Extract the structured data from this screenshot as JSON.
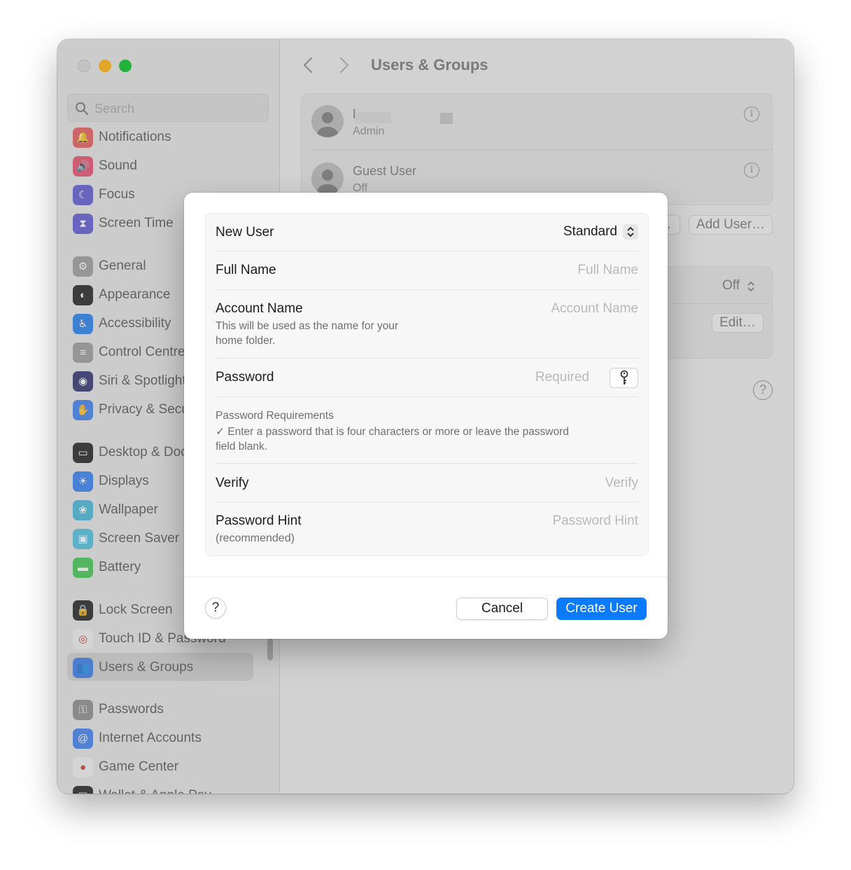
{
  "window": {
    "title": "Users & Groups"
  },
  "sidebar": {
    "search_placeholder": "Search",
    "items": [
      {
        "label": "Notifications",
        "icon": "bell-icon",
        "color": "#e8575b"
      },
      {
        "label": "Sound",
        "icon": "speaker-icon",
        "color": "#e84b6a"
      },
      {
        "label": "Focus",
        "icon": "moon-icon",
        "color": "#5c56d4"
      },
      {
        "label": "Screen Time",
        "icon": "hourglass-icon",
        "color": "#5c56d4"
      },
      {
        "label": "General",
        "icon": "gear-icon",
        "color": "#9b9b9b"
      },
      {
        "label": "Appearance",
        "icon": "appearance-icon",
        "color": "#1c1c1e"
      },
      {
        "label": "Accessibility",
        "icon": "accessibility-icon",
        "color": "#1e7cf1"
      },
      {
        "label": "Control Centre",
        "icon": "toggles-icon",
        "color": "#9b9b9b"
      },
      {
        "label": "Siri & Spotlight",
        "icon": "siri-icon",
        "color": "#2b2b6a"
      },
      {
        "label": "Privacy & Security",
        "icon": "hand-icon",
        "color": "#3a7cf0"
      },
      {
        "label": "Desktop & Dock",
        "icon": "dock-icon",
        "color": "#1c1c1e"
      },
      {
        "label": "Displays",
        "icon": "sun-icon",
        "color": "#2f7cf6"
      },
      {
        "label": "Wallpaper",
        "icon": "flower-icon",
        "color": "#41b8d8"
      },
      {
        "label": "Screen Saver",
        "icon": "screensaver-icon",
        "color": "#49bfe0"
      },
      {
        "label": "Battery",
        "icon": "battery-icon",
        "color": "#3ec650"
      },
      {
        "label": "Lock Screen",
        "icon": "lock-icon",
        "color": "#1c1c1e"
      },
      {
        "label": "Touch ID & Password",
        "icon": "fingerprint-icon",
        "color": "#f2f2f2"
      },
      {
        "label": "Users & Groups",
        "icon": "users-icon",
        "color": "#3a7cf0"
      },
      {
        "label": "Passwords",
        "icon": "key-icon",
        "color": "#8a8a8a"
      },
      {
        "label": "Internet Accounts",
        "icon": "at-icon",
        "color": "#3a7cf0"
      },
      {
        "label": "Game Center",
        "icon": "gamecenter-icon",
        "color": "#f2f2f2"
      },
      {
        "label": "Wallet & Apple Pay",
        "icon": "wallet-icon",
        "color": "#1c1c1e"
      }
    ]
  },
  "main": {
    "users": [
      {
        "name": "l",
        "role": "Admin"
      },
      {
        "name": "Guest User",
        "role": "Off"
      }
    ],
    "add_user_label": "Add User…",
    "off_label": "Off",
    "edit_label": "Edit…",
    "help_label": "?"
  },
  "dialog": {
    "new_user_label": "New User",
    "account_type": "Standard",
    "full_name_label": "Full Name",
    "full_name_placeholder": "Full Name",
    "account_name_label": "Account Name",
    "account_name_placeholder": "Account Name",
    "account_name_note_line1": "This will be used as the name for your",
    "account_name_note_line2": "home folder.",
    "password_label": "Password",
    "password_placeholder": "Required",
    "requirements_title": "Password Requirements",
    "requirements_line1": "✓ Enter a password that is four characters or more or leave the password",
    "requirements_line2": "field blank.",
    "verify_label": "Verify",
    "verify_placeholder": "Verify",
    "hint_label": "Password Hint",
    "hint_sub": "(recommended)",
    "hint_placeholder": "Password Hint",
    "help_label": "?",
    "cancel_label": "Cancel",
    "create_label": "Create User",
    "accent_color": "#0a7aff"
  }
}
